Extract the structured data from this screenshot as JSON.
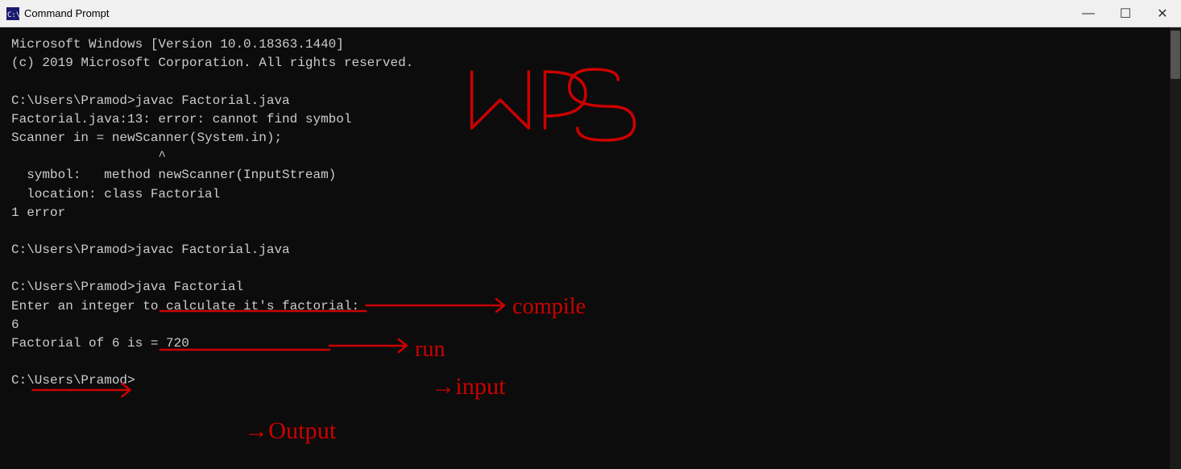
{
  "titlebar": {
    "title": "Command Prompt",
    "icon": "cmd",
    "minimize_label": "—",
    "maximize_label": "☐",
    "close_label": "✕"
  },
  "terminal": {
    "lines": [
      "Microsoft Windows [Version 10.0.18363.1440]",
      "(c) 2019 Microsoft Corporation. All rights reserved.",
      "",
      "C:\\Users\\Pramod>javac Factorial.java",
      "Factorial.java:13: error: cannot find symbol",
      "Scanner in = newScanner(System.in);",
      "                   ^",
      "  symbol:   method newScanner(InputStream)",
      "  location: class Factorial",
      "1 error",
      "",
      "C:\\Users\\Pramod>javac Factorial.java",
      "",
      "C:\\Users\\Pramod>java Factorial",
      "Enter an integer to calculate it's factorial:",
      "6",
      "Factorial of 6 is = 720",
      "",
      "C:\\Users\\Pramod>"
    ]
  }
}
